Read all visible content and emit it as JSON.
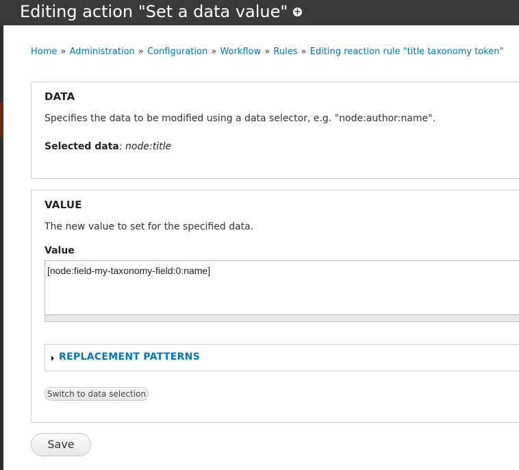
{
  "header": {
    "title": "Editing action \"Set a data value\"",
    "icon": "plus-circle-icon"
  },
  "breadcrumb": [
    "Home",
    "Administration",
    "Configuration",
    "Workflow",
    "Rules",
    "Editing reaction rule \"title taxonomy token\""
  ],
  "breadcrumb_separator": "»",
  "data_section": {
    "legend": "DATA",
    "description": "Specifies the data to be modified using a data selector, e.g. \"node:author:name\".",
    "selected_label": "Selected data",
    "selected_colon": ":",
    "selected_value": "node:title"
  },
  "value_section": {
    "legend": "VALUE",
    "description": "The new value to set for the specified data.",
    "field_label": "Value",
    "field_value": "[node:field-my-taxonomy-field:0:name]",
    "replacement_patterns_label": "REPLACEMENT PATTERNS",
    "switch_button_label": "Switch to data selection"
  },
  "actions": {
    "save_label": "Save"
  },
  "colors": {
    "link": "#0074bd",
    "titlebar": "#3a3a3a",
    "border": "#cccccc"
  }
}
